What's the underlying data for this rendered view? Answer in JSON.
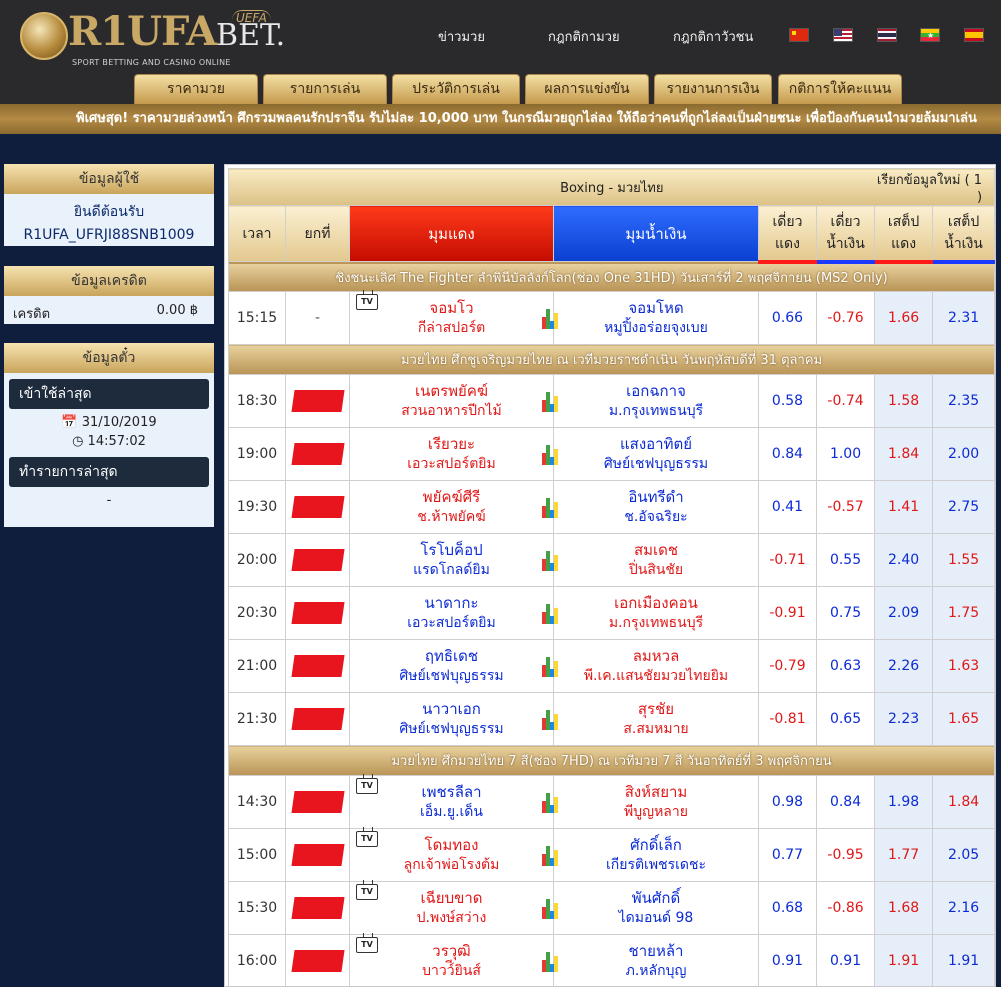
{
  "brand": {
    "logo_main": "R1UFA",
    "logo_bet": "BET.",
    "logo_uefa": "UEFA",
    "logo_sub": "SPORT BETTING AND CASINO ONLINE"
  },
  "topnav": [
    "ข่าวมวย",
    "กฎกติกามวย",
    "กฎกติกาวัวชน"
  ],
  "flags": [
    {
      "name": "cn-flag-icon",
      "colors": [
        "#de2910",
        "#ffde00"
      ]
    },
    {
      "name": "us-flag-icon",
      "colors": [
        "#b22234",
        "#3c3b6e"
      ]
    },
    {
      "name": "th-flag-icon",
      "colors": [
        "#a51931",
        "#2d2a4a"
      ]
    },
    {
      "name": "mm-flag-icon",
      "colors": [
        "#fecb00",
        "#34b233"
      ]
    },
    {
      "name": "es-flag-icon",
      "colors": [
        "#c60b1e",
        "#ffc400"
      ]
    }
  ],
  "tabs": [
    "ราคามวย",
    "รายการเล่น",
    "ประวัติการเล่น",
    "ผลการแข่งขัน",
    "รายงานการเงิน",
    "กติการให้คะแนน"
  ],
  "marquee": "พิเศษสุด! ราคามวยล่วงหน้า ศึกรวมพลคนรักปราจีน รับไม่ละ 10,000 บาท ในกรณีมวยถูกไล่ลง ให้ถือว่าคนที่ถูกไล่ลงเป็นฝ่ายชนะ เพื่อป้องกันคนนำมวยล้มมาเล่น",
  "user_panel": {
    "title": "ข้อมูลผู้ใช้",
    "greeting": "ยินดีต้อนรับ",
    "user_id": "R1UFA_UFRJI88SNB1009"
  },
  "credit_panel": {
    "title": "ข้อมูลเครดิต",
    "label": "เครดิต",
    "value": "0.00 ฿"
  },
  "info_panel": {
    "title": "ข้อมูลตั๋ว",
    "last_login_label": "เข้าใช้ล่าสุด",
    "date": "31/10/2019",
    "time": "14:57:02",
    "last_txn_label": "ทำรายการล่าสุด",
    "last_txn_value": "-"
  },
  "table": {
    "caption": "Boxing - มวยไทย",
    "refresh": "เรียกข้อมูลใหม่ ( 1 )",
    "headers": {
      "time": "เวลา",
      "round": "ยกที่",
      "red": "มุมแดง",
      "blue": "มุมน้ำเงิน",
      "single_red": [
        "เดี่ยว",
        "แดง"
      ],
      "single_blue": [
        "เดี่ยว",
        "น้ำเงิน"
      ],
      "set_red": [
        "เสต็ป",
        "แดง"
      ],
      "set_blue": [
        "เสต็ป",
        "น้ำเงิน"
      ]
    },
    "sections": [
      {
        "title": "ชิงชนะเลิศ The Fighter ลำพินีบัลลังก์โลก(ช่อง One 31HD) วันเสาร์ที่ 2 พฤศจิกายน (MS2 Only)",
        "matches": [
          {
            "time": "15:15",
            "round": "-",
            "flag": false,
            "tv": true,
            "favor": "red",
            "red_name": "จอมโว",
            "red_gym": "กีล่าสปอร์ต",
            "blue_name": "จอมโหด",
            "blue_gym": "หมูปิ้งอร่อยจุงเบย",
            "s_red": "0.66",
            "s_blue": "-0.76",
            "p_red": "1.66",
            "p_blue": "2.31"
          }
        ]
      },
      {
        "title": "มวยไทย ศึกชูเจริญมวยไทย ณ เวทีมวยราชดำเนิน วันพฤหัสบดีที่ 31 ตุลาคม",
        "matches": [
          {
            "time": "18:30",
            "flag": true,
            "tv": false,
            "favor": "red",
            "red_name": "เนตรพยัคฆ์",
            "red_gym": "สวนอาหารปีกไม้",
            "blue_name": "เอกฉกาจ",
            "blue_gym": "ม.กรุงเทพธนบุรี",
            "s_red": "0.58",
            "s_blue": "-0.74",
            "p_red": "1.58",
            "p_blue": "2.35"
          },
          {
            "time": "19:00",
            "flag": true,
            "tv": false,
            "favor": "red",
            "red_name": "เรียวยะ",
            "red_gym": "เอวะสปอร์ตยิม",
            "blue_name": "แสงอาทิตย์",
            "blue_gym": "ศิษย์เชฟบุญธรรม",
            "s_red": "0.84",
            "s_blue": "1.00",
            "p_red": "1.84",
            "p_blue": "2.00"
          },
          {
            "time": "19:30",
            "flag": true,
            "tv": false,
            "favor": "red",
            "red_name": "พยัคฆ์ศีรี",
            "red_gym": "ช.ห้าพยัคฆ์",
            "blue_name": "อินทรีดำ",
            "blue_gym": "ช.อัจฉริยะ",
            "s_red": "0.41",
            "s_blue": "-0.57",
            "p_red": "1.41",
            "p_blue": "2.75"
          },
          {
            "time": "20:00",
            "flag": true,
            "tv": false,
            "favor": "blue",
            "red_name": "โรโบค็อป",
            "red_gym": "แรดโกลด์ยิม",
            "blue_name": "สมเดช",
            "blue_gym": "ปิ่นสินชัย",
            "s_red": "-0.71",
            "s_blue": "0.55",
            "p_red": "2.40",
            "p_blue": "1.55"
          },
          {
            "time": "20:30",
            "flag": true,
            "tv": false,
            "favor": "blue",
            "red_name": "นาดากะ",
            "red_gym": "เอวะสปอร์ตยิม",
            "blue_name": "เอกเมืองคอน",
            "blue_gym": "ม.กรุงเทพธนบุรี",
            "s_red": "-0.91",
            "s_blue": "0.75",
            "p_red": "2.09",
            "p_blue": "1.75"
          },
          {
            "time": "21:00",
            "flag": true,
            "tv": false,
            "favor": "blue",
            "red_name": "ฤทธิเดช",
            "red_gym": "ศิษย์เชฟบุญธรรม",
            "blue_name": "ลมหวล",
            "blue_gym": "พี.เค.แสนชัยมวยไทยยิม",
            "s_red": "-0.79",
            "s_blue": "0.63",
            "p_red": "2.26",
            "p_blue": "1.63"
          },
          {
            "time": "21:30",
            "flag": true,
            "tv": false,
            "favor": "blue",
            "red_name": "นาวาเอก",
            "red_gym": "ศิษย์เชฟบุญธรรม",
            "blue_name": "สุรชัย",
            "blue_gym": "ส.สมหมาย",
            "s_red": "-0.81",
            "s_blue": "0.65",
            "p_red": "2.23",
            "p_blue": "1.65"
          }
        ]
      },
      {
        "title": "มวยไทย ศึกมวยไทย 7 สี(ช่อง 7HD) ณ เวทีมวย 7 สี วันอาทิตย์ที่ 3 พฤศจิกายน",
        "matches": [
          {
            "time": "14:30",
            "flag": true,
            "tv": true,
            "favor": "blue",
            "red_name": "เพชรลีลา",
            "red_gym": "เอ็ม.ยู.เด็น",
            "blue_name": "สิงห์สยาม",
            "blue_gym": "พีบูญหลาย",
            "s_red": "0.98",
            "s_blue": "0.84",
            "p_red": "1.98",
            "p_blue": "1.84"
          },
          {
            "time": "15:00",
            "flag": true,
            "tv": true,
            "favor": "red",
            "red_name": "โดมทอง",
            "red_gym": "ลูกเจ้าพ่อโรงต้ม",
            "blue_name": "ศักดิ์เล็ก",
            "blue_gym": "เกียรติเพชรเดชะ",
            "s_red": "0.77",
            "s_blue": "-0.95",
            "p_red": "1.77",
            "p_blue": "2.05"
          },
          {
            "time": "15:30",
            "flag": true,
            "tv": true,
            "favor": "red",
            "red_name": "เฉียบขาด",
            "red_gym": "ป.พงษ์สว่าง",
            "blue_name": "พันศักดิ์",
            "blue_gym": "ไดมอนด์ 98",
            "s_red": "0.68",
            "s_blue": "-0.86",
            "p_red": "1.68",
            "p_blue": "2.16"
          },
          {
            "time": "16:00",
            "flag": true,
            "tv": true,
            "favor": "red",
            "red_name": "วรวุฒิ",
            "red_gym": "บาวว์ียินส์",
            "blue_name": "ชายหล้า",
            "blue_gym": "ภ.หลักบุญ",
            "s_red": "0.91",
            "s_blue": "0.91",
            "p_red": "1.91",
            "p_blue": "1.91"
          }
        ]
      }
    ]
  }
}
